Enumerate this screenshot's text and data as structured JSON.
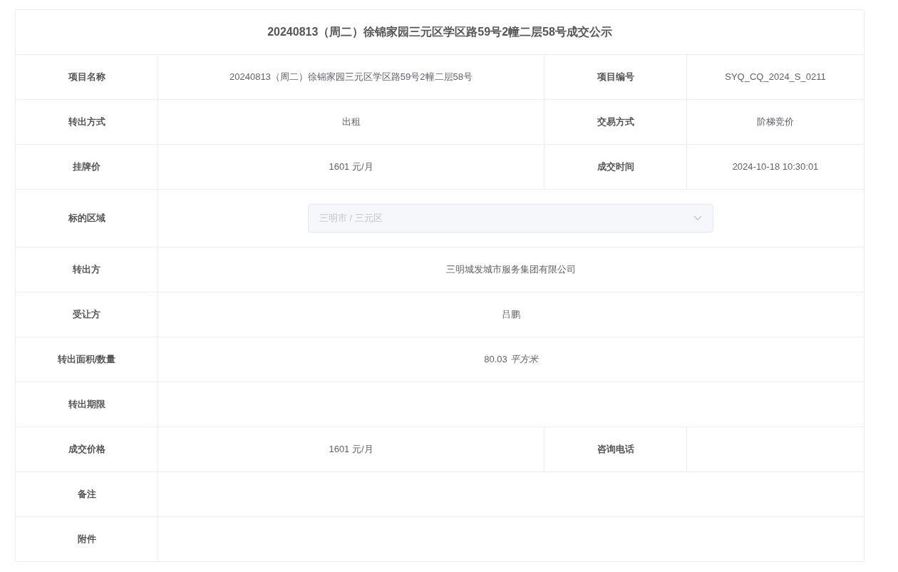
{
  "title": "20240813（周二）徐锦家园三元区学区路59号2幢二层58号成交公示",
  "rows": [
    {
      "kind": "pair",
      "label": "项目名称",
      "value": "20240813（周二）徐锦家园三元区学区路59号2幢二层58号",
      "label_2": "项目编号",
      "value_2": "SYQ_CQ_2024_S_0211"
    },
    {
      "kind": "pair",
      "label": "转出方式",
      "value": "出租",
      "label_2": "交易方式",
      "value_2": "阶梯竞价"
    },
    {
      "kind": "pair",
      "label": "挂牌价",
      "value": "1601 元/月",
      "label_2": "成交时间",
      "value_2": "2024-10-18 10:30:01"
    },
    {
      "kind": "select",
      "label": "标的区域",
      "value": "三明市 / 三元区",
      "disabled": true
    },
    {
      "kind": "full",
      "label": "转出方",
      "value": "三明城发城市服务集团有限公司"
    },
    {
      "kind": "full",
      "label": "受让方",
      "value": "吕鹏"
    },
    {
      "kind": "full",
      "label": "转出面积/数量",
      "value": "80.03",
      "unit": "平方米"
    },
    {
      "kind": "full",
      "label": "转出期限"
    },
    {
      "kind": "pair",
      "label": "成交价格",
      "value": "1601 元/月",
      "label_2": "咨询电话"
    },
    {
      "kind": "full",
      "label": "备注"
    },
    {
      "kind": "full",
      "label": "附件"
    }
  ]
}
